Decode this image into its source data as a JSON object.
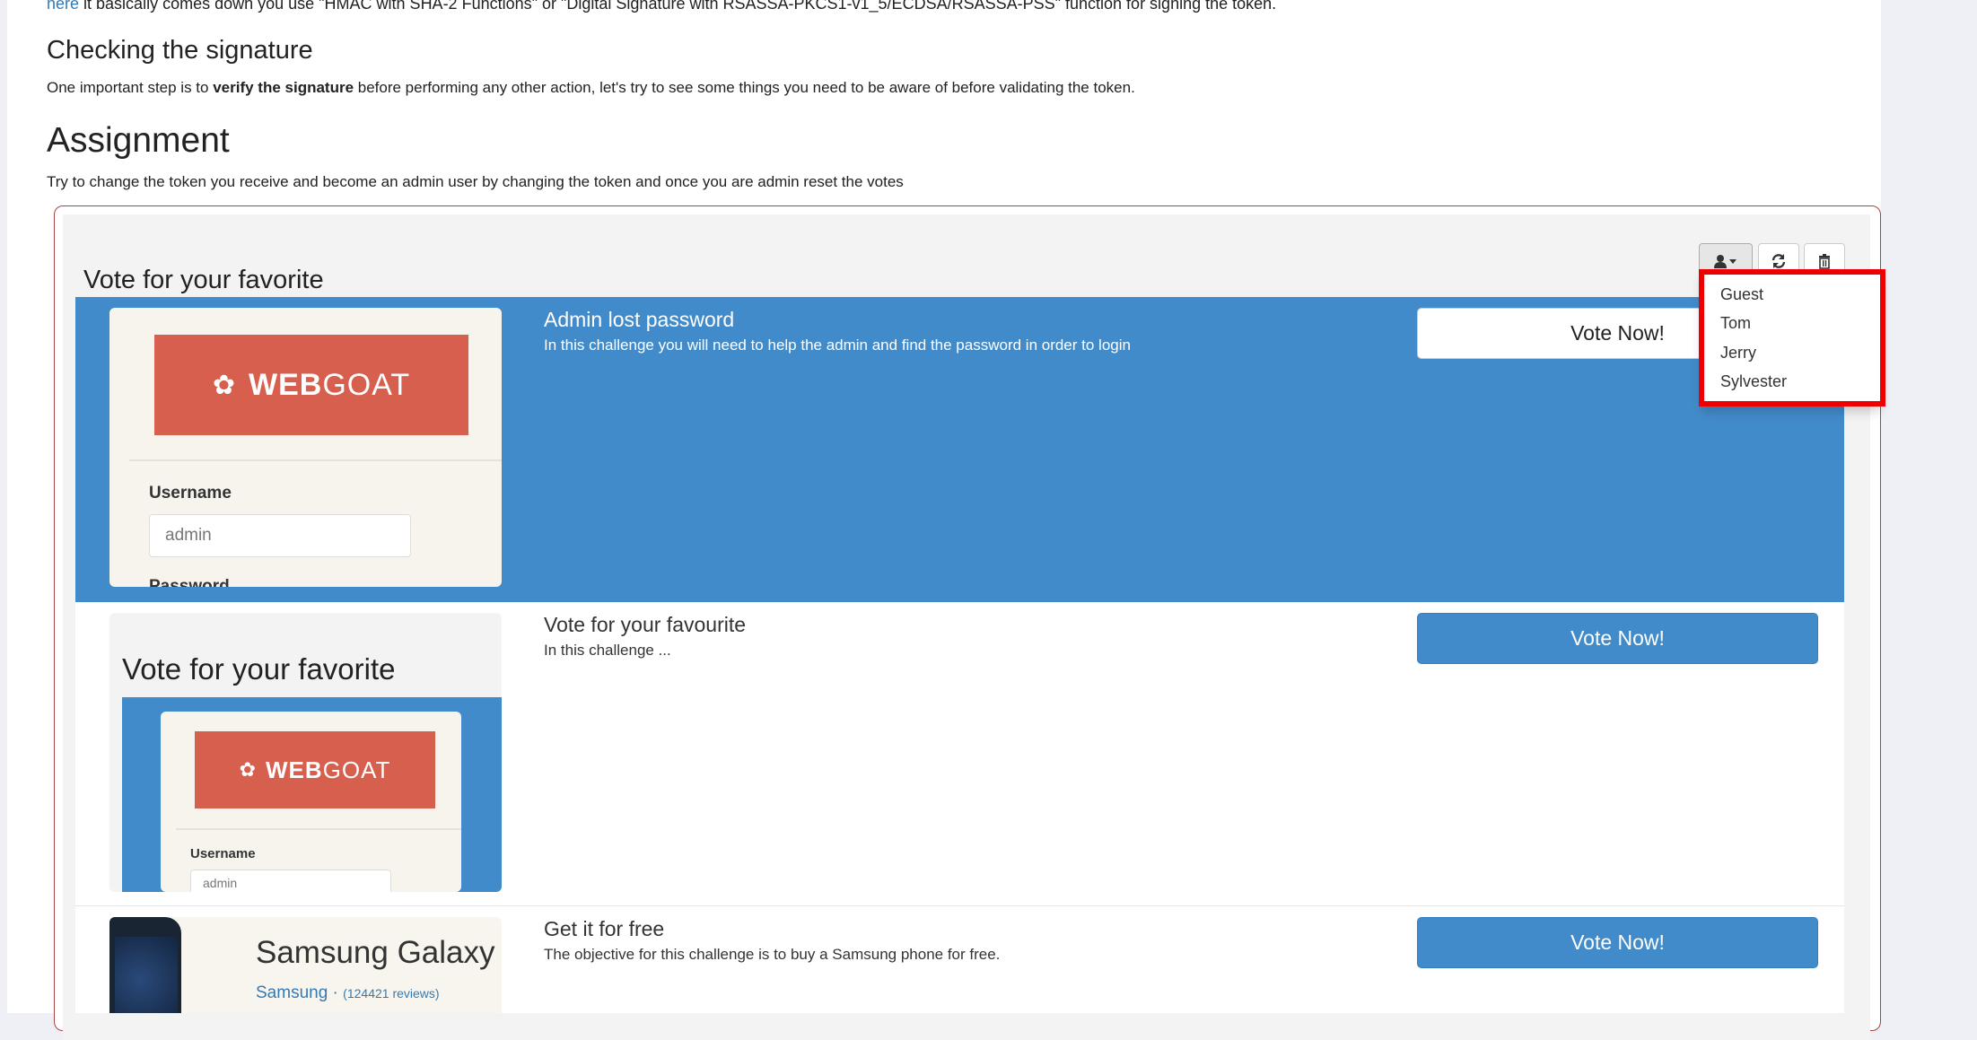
{
  "intro": {
    "link_text": "here",
    "rest": " it basically comes down you use \"HMAC with SHA-2 Functions\" or \"Digital Signature with RSASSA-PKCS1-v1_5/ECDSA/RSASSA-PSS\" function for signing the token."
  },
  "signature": {
    "heading": "Checking the signature",
    "text_before": "One important step is to ",
    "text_bold": "verify the signature",
    "text_after": " before performing any other action, let's try to see some things you need to be aware of before validating the token."
  },
  "assignment": {
    "heading": "Assignment",
    "text": "Try to change the token you receive and become an admin user by changing the token and once you are admin reset the votes"
  },
  "panel": {
    "title": "Vote for your favorite",
    "toolbar": {
      "user_icon": "user-icon",
      "caret_icon": "caret-down-icon",
      "refresh_icon": "refresh-icon",
      "trash_icon": "trash-icon"
    },
    "user_menu": {
      "items": [
        "Guest",
        "Tom",
        "Jerry",
        "Sylvester"
      ],
      "highlight_color": "#ee0000"
    },
    "items": [
      {
        "title": "Admin lost password",
        "description": "In this challenge you will need to help the admin and find the password in order to login",
        "button": "Vote Now!",
        "selected": true
      },
      {
        "title": "Vote for your favourite",
        "description": "In this challenge ...",
        "button": "Vote Now!",
        "selected": false
      },
      {
        "title": "Get it for free",
        "description": "The objective for this challenge is to buy a Samsung phone for free.",
        "button": "Vote Now!",
        "selected": false
      }
    ]
  },
  "thumbnails": {
    "webgoat_logo_bold": "WEB",
    "webgoat_logo_light": "GOAT",
    "username_label": "Username",
    "username_value": "admin",
    "password_label": "Password",
    "nested_title": "Vote for your favorite",
    "samsung_title": "Samsung Galaxy",
    "samsung_brand": "Samsung",
    "samsung_reviews": "(124421 reviews)"
  },
  "colors": {
    "accent": "#428bca",
    "frame_border": "#a94442",
    "webgoat_red": "#d65f4e"
  }
}
